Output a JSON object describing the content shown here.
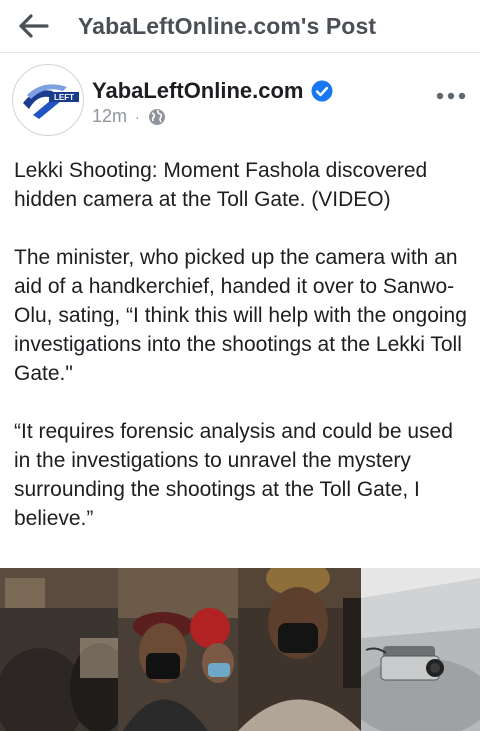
{
  "topbar": {
    "title": "YabaLeftOnline.com's Post"
  },
  "post": {
    "author": "YabaLeftOnline.com",
    "avatar_text": "LEFT",
    "time": "12m",
    "separator": "·",
    "audience_icon": "globe-icon",
    "verified_icon": "verified-badge-icon",
    "paragraphs": [
      "Lekki Shooting: Moment Fashola discovered  hidden camera at the Toll Gate. (VIDEO)",
      "The minister, who picked up the camera with an aid of a handkerchief, handed it over to Sanwo-Olu, sating, “I think this will help with the ongoing investigations into the shootings at the Lekki Toll Gate.\"",
      "“It requires forensic analysis and could be used in the investigations to unravel the mystery surrounding the shootings at the Toll Gate, I believe.”"
    ]
  },
  "colors": {
    "verified_blue": "#1877f2",
    "icon_gray": "#606770",
    "text_primary": "#1c1e21",
    "text_secondary": "#90949c"
  }
}
